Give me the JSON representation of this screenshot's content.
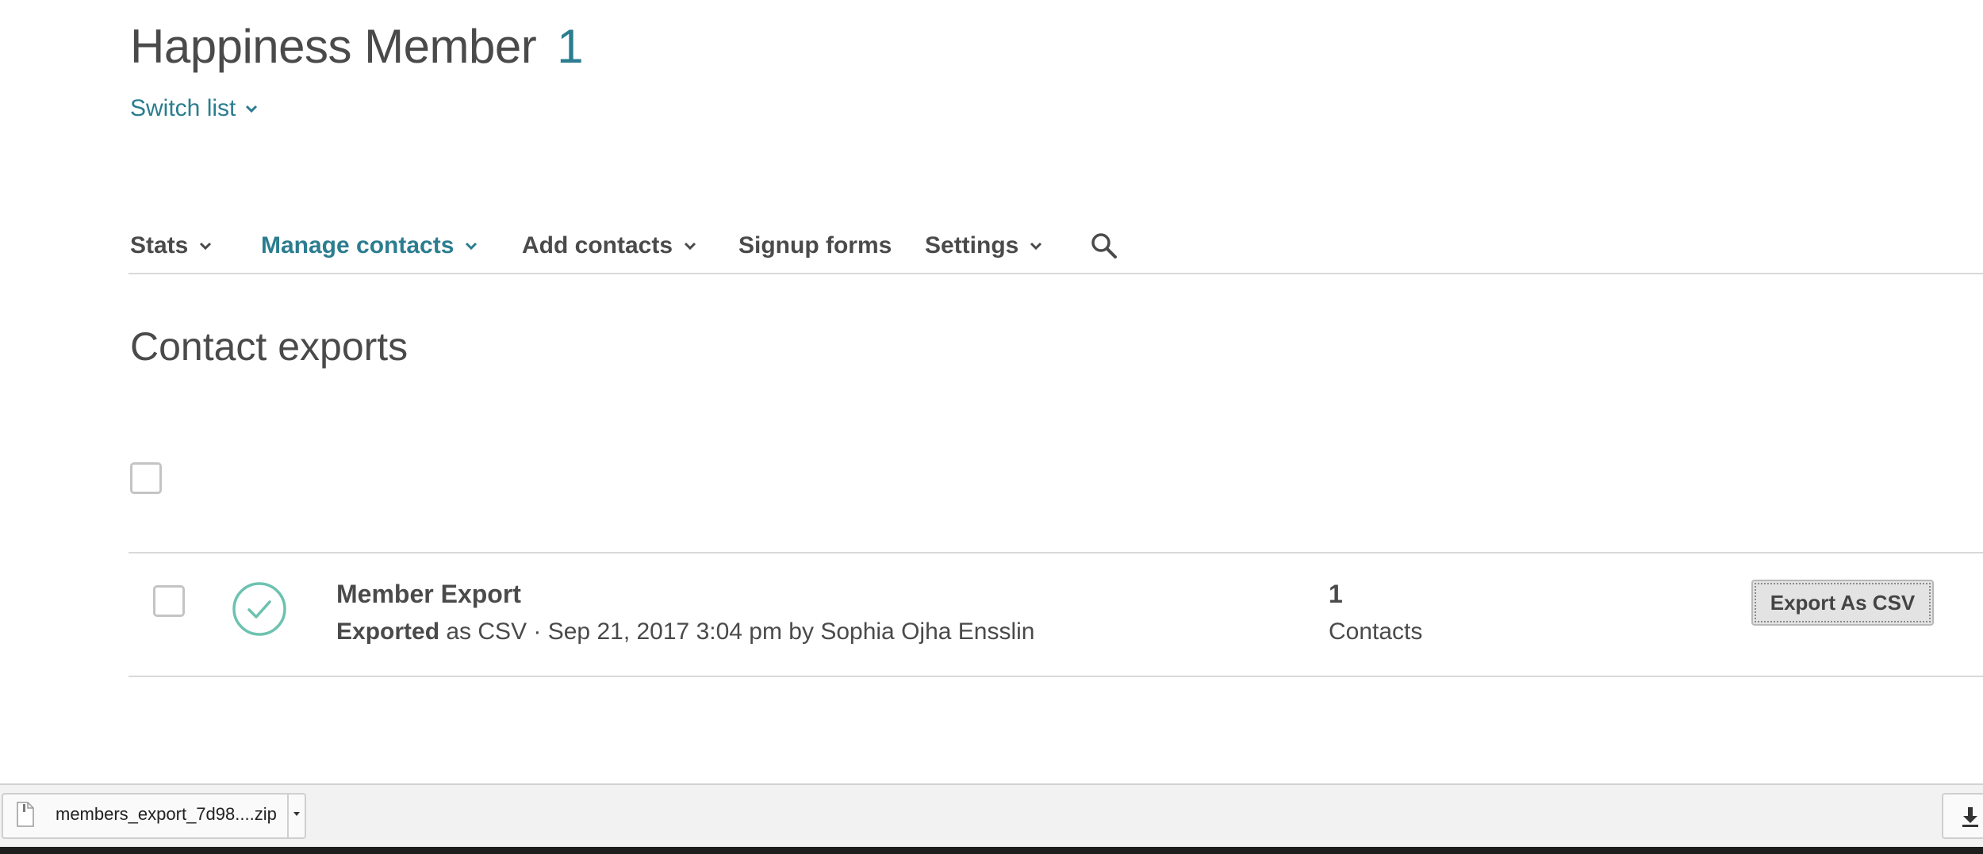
{
  "header": {
    "list_name": "Happiness Member",
    "list_count": "1",
    "switch_list_label": "Switch list"
  },
  "nav": {
    "stats": "Stats",
    "manage_contacts": "Manage contacts",
    "add_contacts": "Add contacts",
    "signup_forms": "Signup forms",
    "settings": "Settings",
    "search_icon": "search-icon",
    "active_item": "Manage contacts"
  },
  "section": {
    "title": "Contact exports"
  },
  "exports": [
    {
      "name": "Member Export",
      "status": "Exported",
      "detail": "as CSV · Sep 21, 2017 3:04 pm by Sophia Ojha Ensslin",
      "count": "1",
      "count_label": "Contacts",
      "action_label": "Export As CSV",
      "status_icon": "check-circle-icon"
    }
  ],
  "download_bar": {
    "file_name": "members_export_7d98....zip",
    "file_icon": "file-icon",
    "show_all_icon": "download-icon"
  },
  "colors": {
    "accent": "#2b7d8f",
    "success": "#6cc2b0",
    "text": "#4a4a4a",
    "divider": "#d9d9d9"
  }
}
